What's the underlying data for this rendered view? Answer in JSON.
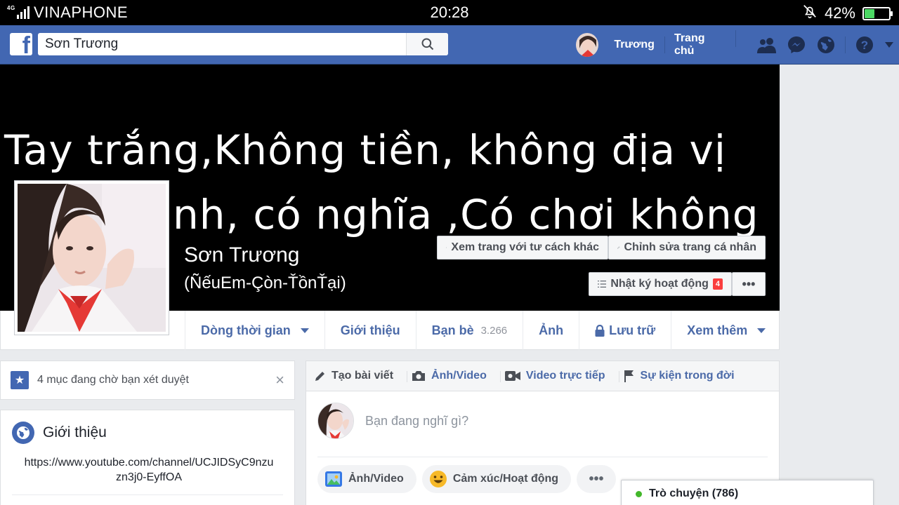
{
  "status_bar": {
    "carrier": "VINAPHONE",
    "network": "4G",
    "time": "20:28",
    "battery_percent": "42%",
    "battery_level": 0.42
  },
  "topbar": {
    "search_value": "Sơn Trương",
    "profile_link": "Trương",
    "home_link": "Trang chủ",
    "accent_color": "#4267b2"
  },
  "cover": {
    "line1": "Tay trắng,Không tiền, không địa vị",
    "line2": "nh, có nghĩa ,Có chơi không",
    "name": "Sơn Trương",
    "alternate_name": "(ÑếuEm-Çòn-ŤồnŤại)",
    "view_as_button": "Xem trang với tư cách khác",
    "edit_profile_button": "Chỉnh sửa trang cá nhân",
    "activity_log_button": "Nhật ký hoạt động",
    "activity_log_badge": "4",
    "more_button": "•••"
  },
  "timeline_nav": {
    "timeline": "Dòng thời gian",
    "about": "Giới thiệu",
    "friends": "Bạn bè",
    "friends_count": "3.266",
    "photos": "Ảnh",
    "archive": "Lưu trữ",
    "more": "Xem thêm"
  },
  "pending": {
    "text": "4 mục đang chờ bạn xét duyệt",
    "close": "×"
  },
  "intro": {
    "title": "Giới thiệu",
    "link": "https://www.youtube.com/channel/UCJIDSyC9nzuzn3j0-EyffOA"
  },
  "composer": {
    "tab_create": "Tạo bài viết",
    "tab_photo": "Ảnh/Video",
    "tab_live": "Video trực tiếp",
    "tab_event": "Sự kiện trong đời",
    "placeholder": "Bạn đang nghĩ gì?",
    "action_photo": "Ảnh/Video",
    "action_feeling": "Cảm xúc/Hoạt động",
    "action_more": "•••"
  },
  "chat": {
    "label": "Trò chuyện (786)"
  },
  "icons": {
    "signal": "signal-icon",
    "mute": "bell-off-icon",
    "battery": "battery-charging-icon",
    "search": "search-icon",
    "friends": "friend-requests-icon",
    "messenger": "messenger-icon",
    "notifications": "globe-notifications-icon",
    "help": "help-icon",
    "menu": "caret-down-icon",
    "eye": "eye-icon",
    "pencil": "pencil-icon",
    "list": "list-icon",
    "lock": "lock-icon",
    "star": "star-icon",
    "globe": "globe-icon",
    "camera": "camera-icon",
    "video": "video-camera-icon",
    "flag": "flag-icon",
    "image": "photo-icon",
    "emoji": "smiley-icon"
  }
}
